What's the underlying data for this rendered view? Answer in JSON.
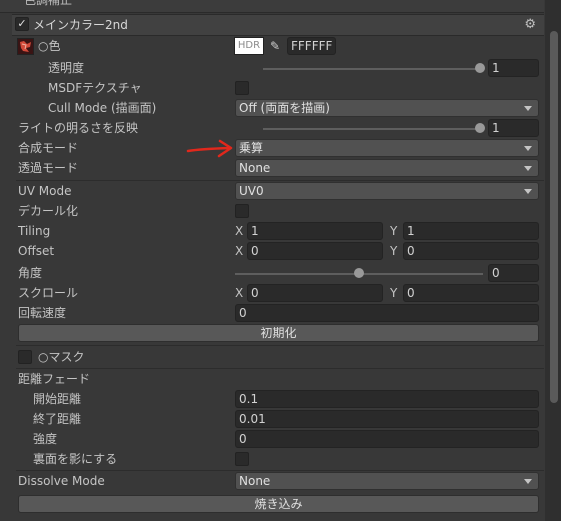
{
  "header": {
    "title": "メインカラー2nd",
    "top_label": "色調補正"
  },
  "color": {
    "label": "○色",
    "hdr": "HDR",
    "hex": "FFFFFF"
  },
  "opacity": {
    "label": "透明度",
    "value": "1",
    "level": 1.0
  },
  "msdf": {
    "label": "MSDFテクスチャ"
  },
  "cull": {
    "label": "Cull Mode (描画面)",
    "value": "Off (両面を描画)"
  },
  "light": {
    "label": "ライトの明るさを反映",
    "value": "1",
    "level": 1.0
  },
  "blend": {
    "label": "合成モード",
    "value": "乗算"
  },
  "trans": {
    "label": "透過モード",
    "value": "None"
  },
  "uvmode": {
    "label": "UV Mode",
    "value": "UV0"
  },
  "decal": {
    "label": "デカール化"
  },
  "tiling": {
    "label": "Tiling",
    "x_label": "X",
    "x": "1",
    "y_label": "Y",
    "y": "1"
  },
  "offset": {
    "label": "Offset",
    "x_label": "X",
    "x": "0",
    "y_label": "Y",
    "y": "0"
  },
  "angle": {
    "label": "角度",
    "value": "0",
    "level": 0.5
  },
  "scroll": {
    "label": "スクロール",
    "x_label": "X",
    "x": "0",
    "y_label": "Y",
    "y": "0"
  },
  "rotspeed": {
    "label": "回転速度",
    "value": "0"
  },
  "reset": {
    "label": "初期化"
  },
  "mask": {
    "label": "○マスク"
  },
  "fade": {
    "label": "距離フェード",
    "start_label": "開始距離",
    "start": "0.1",
    "end_label": "終了距離",
    "end": "0.01",
    "strength_label": "強度",
    "strength": "0",
    "backshadow_label": "裏面を影にする"
  },
  "dissolve": {
    "label": "Dissolve Mode",
    "value": "None"
  },
  "bake": {
    "label": "焼き込み"
  },
  "colors": {
    "accent_arrow": "#e0281c",
    "panel": "#383838",
    "field": "#2a2a2a"
  }
}
